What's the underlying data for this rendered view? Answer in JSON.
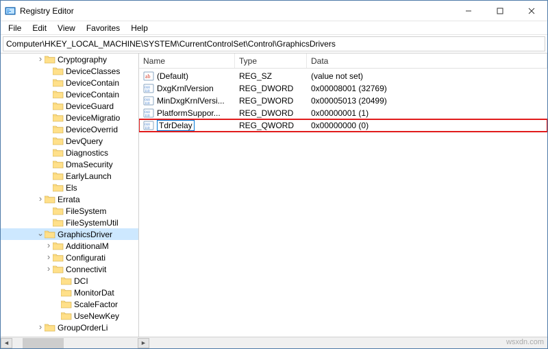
{
  "window": {
    "title": "Registry Editor"
  },
  "menubar": {
    "items": [
      "File",
      "Edit",
      "View",
      "Favorites",
      "Help"
    ]
  },
  "addressbar": {
    "path": "Computer\\HKEY_LOCAL_MACHINE\\SYSTEM\\CurrentControlSet\\Control\\GraphicsDrivers"
  },
  "tree": {
    "items": [
      {
        "indent": 4,
        "twist": "closed",
        "label": "Cryptography"
      },
      {
        "indent": 5,
        "twist": "none",
        "label": "DeviceClasses"
      },
      {
        "indent": 5,
        "twist": "none",
        "label": "DeviceContain"
      },
      {
        "indent": 5,
        "twist": "none",
        "label": "DeviceContain"
      },
      {
        "indent": 5,
        "twist": "none",
        "label": "DeviceGuard"
      },
      {
        "indent": 5,
        "twist": "none",
        "label": "DeviceMigratio"
      },
      {
        "indent": 5,
        "twist": "none",
        "label": "DeviceOverrid"
      },
      {
        "indent": 5,
        "twist": "none",
        "label": "DevQuery"
      },
      {
        "indent": 5,
        "twist": "none",
        "label": "Diagnostics"
      },
      {
        "indent": 5,
        "twist": "none",
        "label": "DmaSecurity"
      },
      {
        "indent": 5,
        "twist": "none",
        "label": "EarlyLaunch"
      },
      {
        "indent": 5,
        "twist": "none",
        "label": "Els"
      },
      {
        "indent": 4,
        "twist": "closed",
        "label": "Errata"
      },
      {
        "indent": 5,
        "twist": "none",
        "label": "FileSystem"
      },
      {
        "indent": 5,
        "twist": "none",
        "label": "FileSystemUtil"
      },
      {
        "indent": 4,
        "twist": "open",
        "label": "GraphicsDriver",
        "selected": true
      },
      {
        "indent": 5,
        "twist": "closed",
        "label": "AdditionalM"
      },
      {
        "indent": 5,
        "twist": "closed",
        "label": "Configurati"
      },
      {
        "indent": 5,
        "twist": "closed",
        "label": "Connectivit"
      },
      {
        "indent": 6,
        "twist": "none",
        "label": "DCI"
      },
      {
        "indent": 6,
        "twist": "none",
        "label": "MonitorDat"
      },
      {
        "indent": 6,
        "twist": "none",
        "label": "ScaleFactor"
      },
      {
        "indent": 6,
        "twist": "none",
        "label": "UseNewKey"
      },
      {
        "indent": 4,
        "twist": "closed",
        "label": "GroupOrderLi"
      }
    ]
  },
  "list": {
    "headers": {
      "name": "Name",
      "type": "Type",
      "data": "Data"
    },
    "rows": [
      {
        "icon": "sz",
        "name": "(Default)",
        "type": "REG_SZ",
        "data": "(value not set)"
      },
      {
        "icon": "bin",
        "name": "DxgKrnlVersion",
        "type": "REG_DWORD",
        "data": "0x00008001 (32769)"
      },
      {
        "icon": "bin",
        "name": "MinDxgKrnlVersi...",
        "type": "REG_DWORD",
        "data": "0x00005013 (20499)"
      },
      {
        "icon": "bin",
        "name": "PlatformSuppor...",
        "type": "REG_DWORD",
        "data": "0x00000001 (1)"
      },
      {
        "icon": "bin",
        "name": "TdrDelay",
        "type": "REG_QWORD",
        "data": "0x00000000 (0)",
        "highlight": true,
        "editing": true
      }
    ]
  },
  "watermark": "wsxdn.com"
}
